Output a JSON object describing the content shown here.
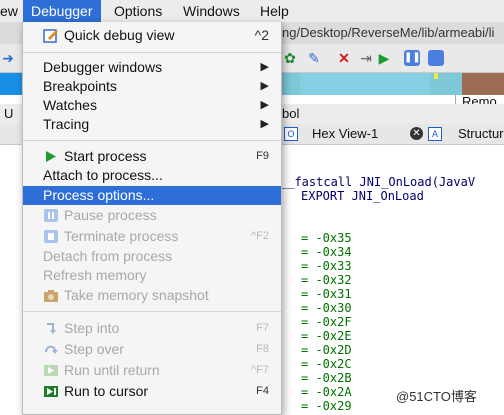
{
  "menubar": {
    "items": [
      {
        "label": "ew"
      },
      {
        "label": "Debugger"
      },
      {
        "label": "Options"
      },
      {
        "label": "Windows"
      },
      {
        "label": "Help"
      }
    ]
  },
  "pathbar": {
    "path": "ng/Desktop/ReverseMe/lib/armeabi/li"
  },
  "toolbar": {
    "remote_label": "Remo"
  },
  "tabs": {
    "row1_left": "U",
    "row1_mid": "bol",
    "hex_view": "Hex View-1",
    "structures": "Structur",
    "hex_view_icon": "O",
    "structures_icon": "A"
  },
  "code": {
    "line1": "__fastcall JNI_OnLoad(JavaV",
    "line2": "EXPORT JNI_OnLoad",
    "values": [
      "= -0x35",
      "= -0x34",
      "= -0x33",
      "= -0x32",
      "= -0x31",
      "= -0x30",
      "= -0x2F",
      "= -0x2E",
      "= -0x2D",
      "= -0x2C",
      "= -0x2B",
      "= -0x2A",
      "= -0x29"
    ]
  },
  "watermark": "@51CTO博客",
  "menu": {
    "quick_debug": {
      "label": "Quick debug view",
      "shortcut": "^2"
    },
    "debugger_windows": {
      "label": "Debugger windows"
    },
    "breakpoints": {
      "label": "Breakpoints"
    },
    "watches": {
      "label": "Watches"
    },
    "tracing": {
      "label": "Tracing"
    },
    "start_process": {
      "label": "Start process",
      "shortcut": "F9"
    },
    "attach": {
      "label": "Attach to process..."
    },
    "process_options": {
      "label": "Process options..."
    },
    "pause": {
      "label": "Pause process"
    },
    "terminate": {
      "label": "Terminate process",
      "shortcut": "^F2"
    },
    "detach": {
      "label": "Detach from process"
    },
    "refresh": {
      "label": "Refresh memory"
    },
    "snapshot": {
      "label": "Take memory snapshot"
    },
    "step_into": {
      "label": "Step into",
      "shortcut": "F7"
    },
    "step_over": {
      "label": "Step over",
      "shortcut": "F8"
    },
    "run_until_return": {
      "label": "Run until return",
      "shortcut": "^F7"
    },
    "run_to_cursor": {
      "label": "Run to cursor",
      "shortcut": "F4"
    }
  },
  "colors": {
    "highlight": "#2d6fd6",
    "navband": "#1a8fe6"
  }
}
